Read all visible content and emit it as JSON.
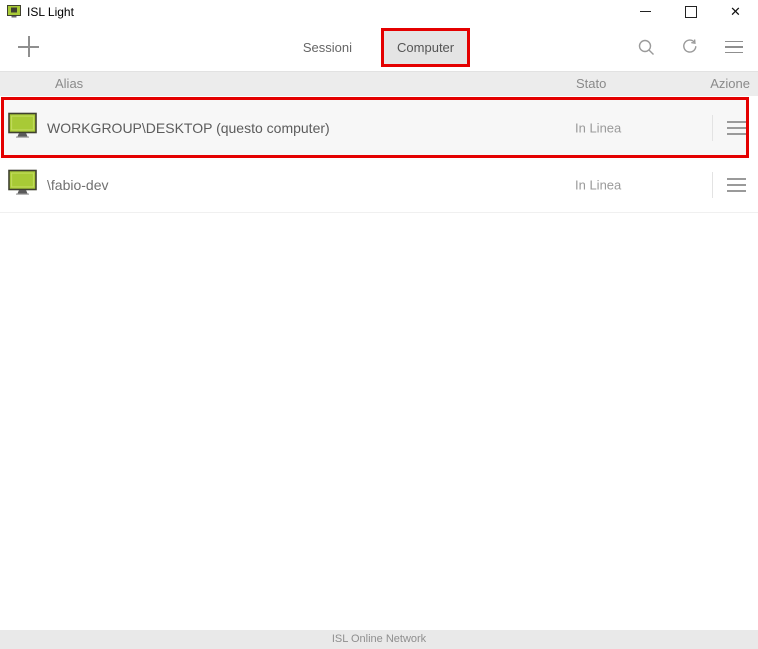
{
  "window": {
    "title": "ISL Light"
  },
  "toolbar": {
    "tabs": [
      {
        "label": "Sessioni",
        "selected": false
      },
      {
        "label": "Computer",
        "selected": true,
        "annotated": true
      }
    ],
    "icon_names": [
      "plus-icon",
      "search-icon",
      "refresh-icon",
      "menu-icon"
    ]
  },
  "table": {
    "headers": {
      "alias": "Alias",
      "stato": "Stato",
      "azione": "Azione"
    },
    "rows": [
      {
        "alias": "WORKGROUP\\DESKTOP (questo computer)",
        "stato": "In Linea",
        "highlighted": true
      },
      {
        "alias": "\\fabio-dev",
        "stato": "In Linea",
        "highlighted": false
      }
    ]
  },
  "footer": {
    "text": "ISL Online Network"
  },
  "colors": {
    "annotation_red": "#e40000",
    "monitor_green": "#a8ca36",
    "monitor_border": "#3f4030",
    "selected_tab_bg": "#e4e4e4",
    "header_bg": "#ececec",
    "footer_bg": "#e9e9e9"
  }
}
